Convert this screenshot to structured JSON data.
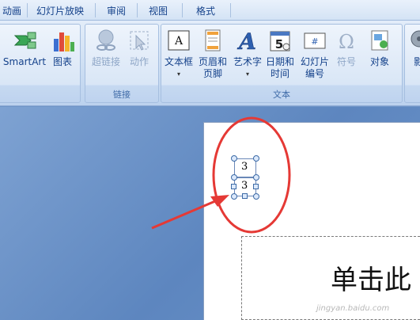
{
  "tabs": [
    {
      "label": "动画"
    },
    {
      "label": "幻灯片放映"
    },
    {
      "label": "审阅"
    },
    {
      "label": "视图"
    },
    {
      "label": "格式"
    }
  ],
  "ribbon": {
    "illustrations": {
      "smartart": "SmartArt",
      "chart": "图表"
    },
    "links": {
      "group_label": "链接",
      "hyperlink": "超链接",
      "action": "动作"
    },
    "text": {
      "group_label": "文本",
      "textbox": "文本框",
      "header_footer_1": "页眉和",
      "header_footer_2": "页脚",
      "wordart": "艺术字",
      "datetime_1": "日期和",
      "datetime_2": "时间",
      "slide_number_1": "幻灯片",
      "slide_number_2": "编号",
      "symbol": "符号",
      "object": "对象"
    },
    "media": {
      "movie_partial": "影"
    }
  },
  "icons": {
    "smartart": "smartart-icon",
    "chart": "chart-icon",
    "hyperlink": "hyperlink-icon",
    "action": "action-icon",
    "textbox": "textbox-icon",
    "header_footer": "header-footer-icon",
    "wordart": "wordart-icon",
    "datetime": "calendar-icon",
    "slide_number": "slide-number-icon",
    "symbol": "omega-icon",
    "object": "object-icon",
    "movie": "film-reel-icon"
  },
  "slide": {
    "textbox_top_value": "3",
    "textbox_bottom_value": "3",
    "title_placeholder": "单击此"
  },
  "colors": {
    "annotation_red": "#e53935",
    "ribbon_text": "#15428b",
    "workspace_blue": "#6f95c8"
  },
  "watermark": "jingyan.baidu.com"
}
